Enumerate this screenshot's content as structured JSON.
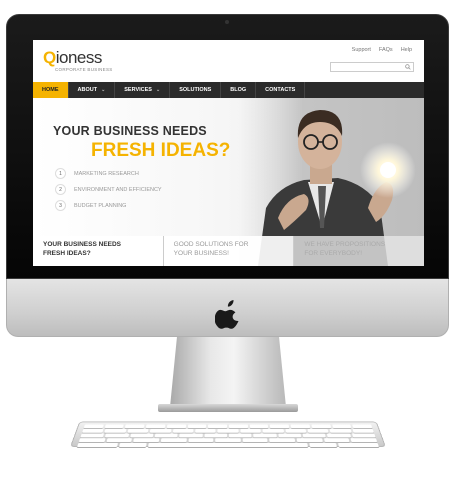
{
  "site": {
    "logo_text": "Qioness",
    "logo_first_letter": "Q",
    "logo_rest": "ioness",
    "tagline": "CORPORATE BUSINESS",
    "brand_color": "#f5b301",
    "dark_color": "#2b2b2b"
  },
  "toplinks": [
    "Support",
    "FAQs",
    "Help"
  ],
  "search": {
    "placeholder": "",
    "icon": "search-icon"
  },
  "nav": [
    {
      "label": "HOME",
      "active": true,
      "dropdown": false
    },
    {
      "label": "ABOUT",
      "active": false,
      "dropdown": true
    },
    {
      "label": "SERVICES",
      "active": false,
      "dropdown": true
    },
    {
      "label": "SOLUTIONS",
      "active": false,
      "dropdown": false
    },
    {
      "label": "BLOG",
      "active": false,
      "dropdown": false
    },
    {
      "label": "CONTACTS",
      "active": false,
      "dropdown": false
    }
  ],
  "hero": {
    "headline_line1": "YOUR BUSINESS NEEDS",
    "headline_line2": "FRESH IDEAS?",
    "features": [
      {
        "num": "1",
        "label": "MARKETING RESEARCH"
      },
      {
        "num": "2",
        "label": "ENVIRONMENT AND EFFICIENCY"
      },
      {
        "num": "3",
        "label": "BUDGET PLANNING"
      }
    ]
  },
  "boxes": [
    {
      "line1": "YOUR BUSINESS NEEDS",
      "line2": "FRESH IDEAS?"
    },
    {
      "line1": "GOOD SOLUTIONS FOR",
      "line2": "YOUR BUSINESS!"
    },
    {
      "line1": "WE HAVE PROPOSITIONS",
      "line2": "FOR EVERYBODY!"
    }
  ]
}
